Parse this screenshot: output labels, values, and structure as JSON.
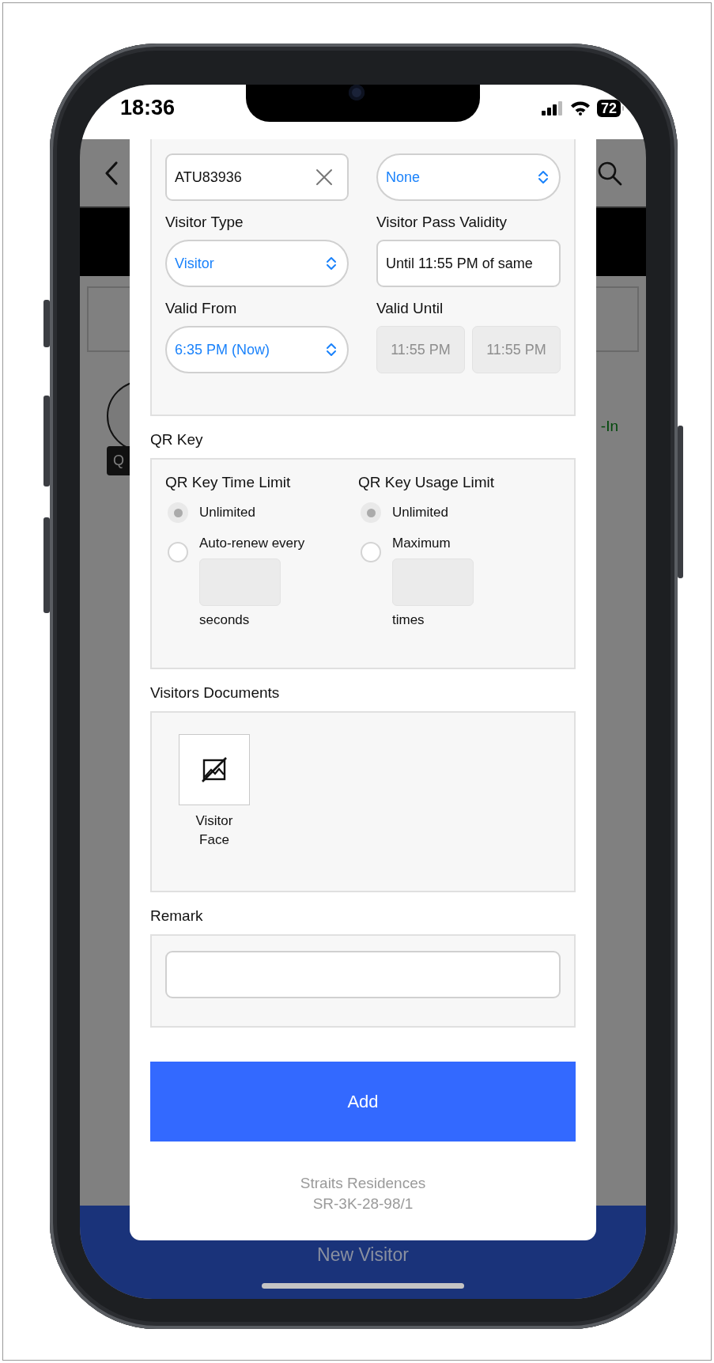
{
  "status_bar": {
    "time": "18:36",
    "battery": "72"
  },
  "background_screen": {
    "chip_label": "Q",
    "status_text": "-In",
    "bottom_bar_title": "New Visitor"
  },
  "dialog": {
    "visit_fields": [
      {
        "kind": "clearable_text",
        "value": "ATU83936"
      },
      {
        "kind": "select",
        "value": "None"
      },
      {
        "kind": "select",
        "label": "Visitor Type",
        "value": "Visitor"
      },
      {
        "kind": "text",
        "label": "Visitor Pass Validity",
        "value": "Until 11:55 PM of same"
      },
      {
        "kind": "select",
        "label": "Valid From",
        "value": "6:35 PM (Now)"
      },
      {
        "kind": "disabled_pair",
        "label": "Valid Until",
        "values": [
          "11:55 PM",
          "11:55 PM"
        ]
      }
    ],
    "qr_key": {
      "title": "QR Key",
      "groups": [
        {
          "title": "QR Key Time Limit",
          "options": [
            {
              "label": "Unlimited",
              "selected": true
            },
            {
              "label": "Auto-renew every",
              "selected": false,
              "unit": "seconds"
            }
          ]
        },
        {
          "title": "QR Key Usage Limit",
          "options": [
            {
              "label": "Unlimited",
              "selected": true
            },
            {
              "label": "Maximum",
              "selected": false,
              "unit": "times"
            }
          ]
        }
      ]
    },
    "documents": {
      "title": "Visitors Documents",
      "items": [
        {
          "label": "Visitor Face"
        }
      ]
    },
    "remark": {
      "title": "Remark"
    },
    "submit_button": "Add",
    "footer": [
      "Straits Residences",
      "SR-3K-28-98/1"
    ]
  }
}
